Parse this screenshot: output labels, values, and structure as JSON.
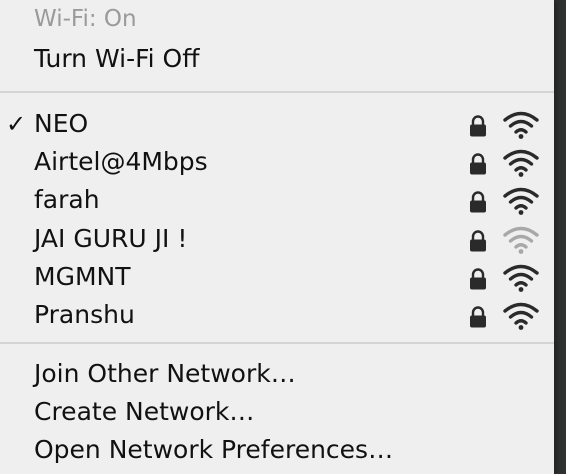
{
  "status": {
    "label": "Wi-Fi: On"
  },
  "toggle": {
    "label": "Turn Wi-Fi Off"
  },
  "networks": [
    {
      "name": "NEO",
      "checked": true,
      "locked": true,
      "signal": "full"
    },
    {
      "name": "Airtel@4Mbps",
      "checked": false,
      "locked": true,
      "signal": "full"
    },
    {
      "name": "farah",
      "checked": false,
      "locked": true,
      "signal": "full"
    },
    {
      "name": "JAI GURU JI !",
      "checked": false,
      "locked": true,
      "signal": "weak"
    },
    {
      "name": "MGMNT",
      "checked": false,
      "locked": true,
      "signal": "full"
    },
    {
      "name": "Pranshu",
      "checked": false,
      "locked": true,
      "signal": "full"
    }
  ],
  "actions": {
    "join_other": "Join Other Network…",
    "create": "Create Network…",
    "preferences": "Open Network Preferences…"
  },
  "icons": {
    "check": "checkmark-icon",
    "lock": "lock-icon",
    "wifi": "wifi-signal-icon"
  },
  "colors": {
    "menu_bg": "#f6f6f6",
    "text": "#111111",
    "header_text": "#9a9a9a",
    "icon": "#2a2a2a",
    "icon_weak": "#a8a8a8"
  }
}
